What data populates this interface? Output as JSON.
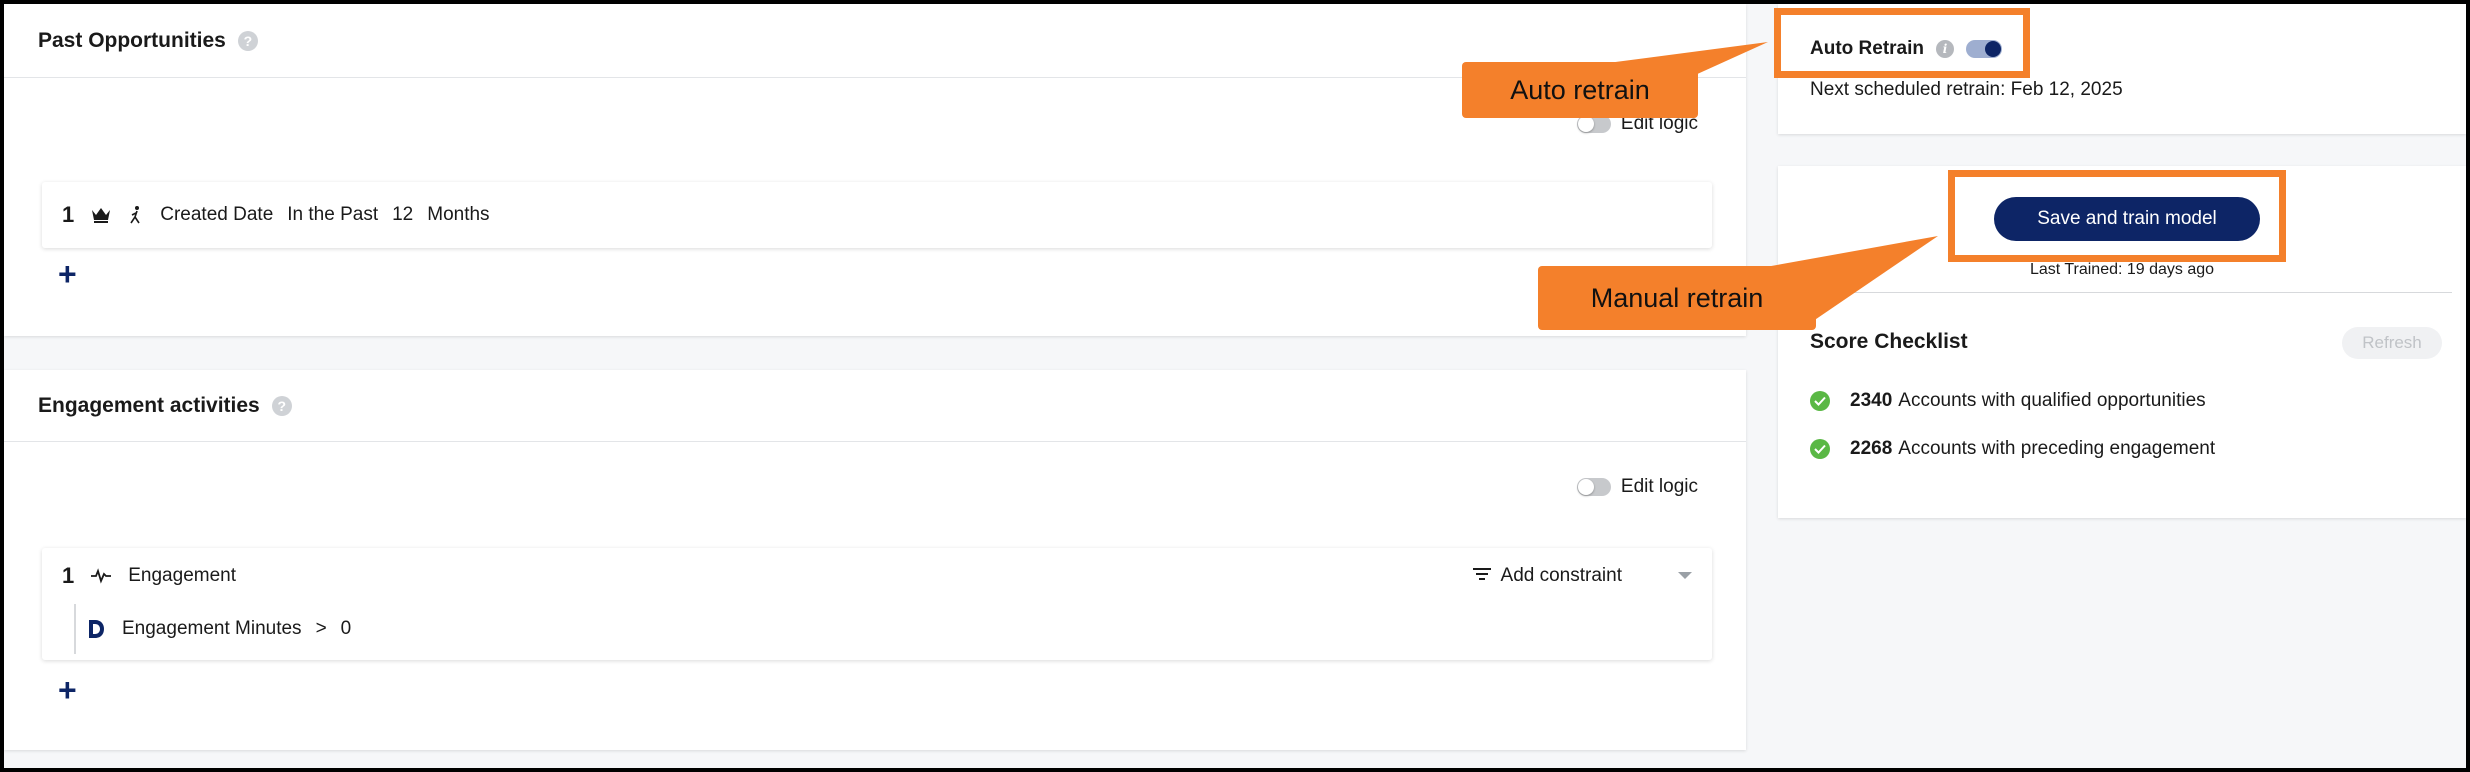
{
  "past_opportunities": {
    "title": "Past Opportunities",
    "edit_logic_label": "Edit logic",
    "rule": {
      "number": "1",
      "icons": [
        "crown-icon",
        "person-walking-icon"
      ],
      "field": "Created Date",
      "operator": "In the Past",
      "value": "12",
      "unit": "Months"
    },
    "add_label": "+"
  },
  "engagement": {
    "title": "Engagement activities",
    "edit_logic_label": "Edit logic",
    "rule": {
      "number": "1",
      "icon": "activity-pulse-icon",
      "label": "Engagement",
      "add_constraint_label": "Add constraint",
      "sub": {
        "icon": "d-logo-icon",
        "field": "Engagement Minutes",
        "operator": ">",
        "value": "0"
      }
    },
    "add_label": "+"
  },
  "auto_retrain": {
    "label": "Auto Retrain",
    "enabled": true,
    "next_scheduled": "Next scheduled retrain: Feb 12, 2025"
  },
  "manual": {
    "button_label": "Save and train model",
    "last_trained": "Last Trained: 19 days ago"
  },
  "checklist": {
    "title": "Score Checklist",
    "refresh_label": "Refresh",
    "items": [
      {
        "count": "2340",
        "label": "Accounts with qualified opportunities"
      },
      {
        "count": "2268",
        "label": "Accounts with preceding engagement"
      }
    ]
  },
  "callouts": {
    "auto": "Auto retrain",
    "manual": "Manual retrain"
  },
  "colors": {
    "accent": "#0d2566",
    "callout": "#f4802b",
    "check": "#5ab845"
  }
}
